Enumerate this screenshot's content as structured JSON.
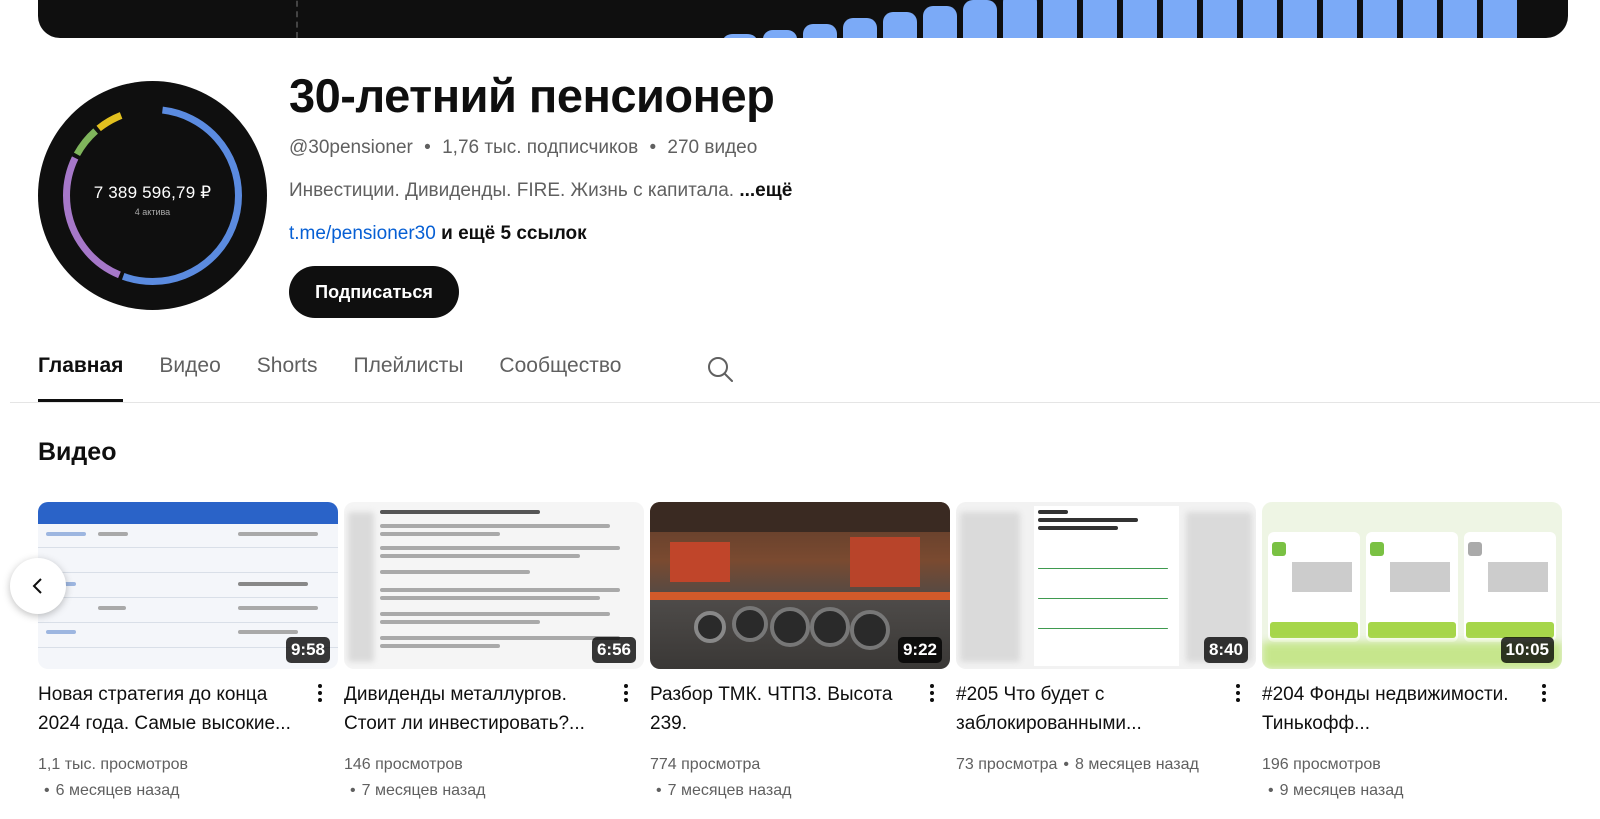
{
  "channel": {
    "name": "30-летний пенсионер",
    "handle": "@30pensioner",
    "subscribers": "1,76 тыс. подписчиков",
    "videos_count": "270 видео",
    "sep": "•",
    "description": "Инвестиции. Дивиденды. FIRE. Жизнь с капитала. ",
    "description_more": "...ещё",
    "link": "t.me/pensioner30",
    "more_links": " и ещё 5 ссылок",
    "subscribe_label": "Подписаться",
    "avatar_amount": "7 389 596,79 ₽",
    "avatar_sub": "4 актива"
  },
  "colors": {
    "accent_blue": "#065fd4",
    "banner_bar": "#7baaf7",
    "ring_blue": "#5b8be0",
    "ring_purple": "#a678c9",
    "ring_green": "#7fb55c",
    "ring_yellow": "#e2c01f"
  },
  "tabs": [
    {
      "label": "Главная",
      "active": true
    },
    {
      "label": "Видео",
      "active": false
    },
    {
      "label": "Shorts",
      "active": false
    },
    {
      "label": "Плейлисты",
      "active": false
    },
    {
      "label": "Сообщество",
      "active": false
    }
  ],
  "section": {
    "title": "Видео"
  },
  "videos": [
    {
      "title": "Новая стратегия до конца 2024 года. Самые высокие...",
      "duration": "9:58",
      "views": "1,1 тыс. просмотров",
      "age": "6 месяцев назад"
    },
    {
      "title": "Дивиденды металлургов. Стоит ли инвестировать?...",
      "duration": "6:56",
      "views": "146 просмотров",
      "age": "7 месяцев назад"
    },
    {
      "title": "Разбор ТМК. ЧТПЗ. Высота 239.",
      "duration": "9:22",
      "views": "774 просмотра",
      "age": "7 месяцев назад"
    },
    {
      "title": "#205 Что будет с заблокированными...",
      "duration": "8:40",
      "views": "73 просмотра",
      "age": "8 месяцев назад"
    },
    {
      "title": "#204 Фонды недвижимости. Тинькофф...",
      "duration": "10:05",
      "views": "196 просмотров",
      "age": "9 месяцев назад"
    }
  ]
}
